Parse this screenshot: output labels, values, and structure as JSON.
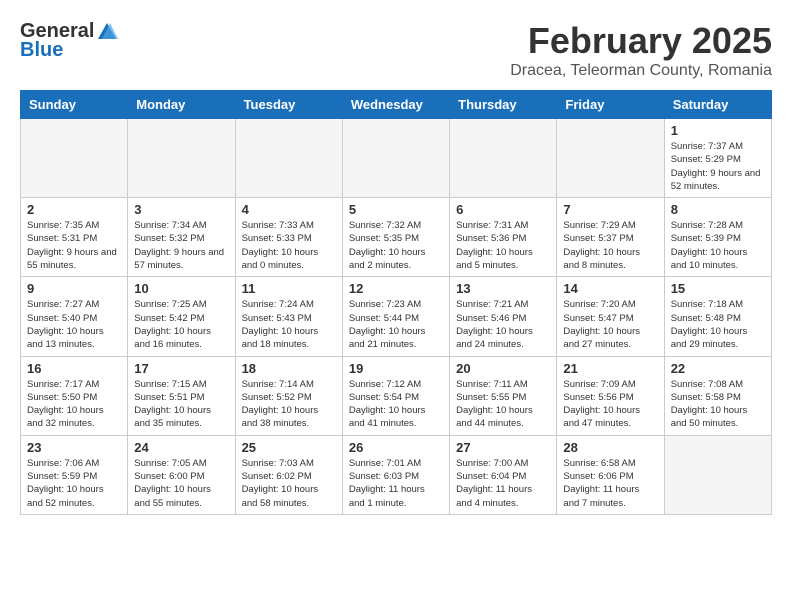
{
  "header": {
    "logo_general": "General",
    "logo_blue": "Blue",
    "title": "February 2025",
    "subtitle": "Dracea, Teleorman County, Romania"
  },
  "weekdays": [
    "Sunday",
    "Monday",
    "Tuesday",
    "Wednesday",
    "Thursday",
    "Friday",
    "Saturday"
  ],
  "weeks": [
    [
      {
        "day": "",
        "info": ""
      },
      {
        "day": "",
        "info": ""
      },
      {
        "day": "",
        "info": ""
      },
      {
        "day": "",
        "info": ""
      },
      {
        "day": "",
        "info": ""
      },
      {
        "day": "",
        "info": ""
      },
      {
        "day": "1",
        "info": "Sunrise: 7:37 AM\nSunset: 5:29 PM\nDaylight: 9 hours and 52 minutes."
      }
    ],
    [
      {
        "day": "2",
        "info": "Sunrise: 7:35 AM\nSunset: 5:31 PM\nDaylight: 9 hours and 55 minutes."
      },
      {
        "day": "3",
        "info": "Sunrise: 7:34 AM\nSunset: 5:32 PM\nDaylight: 9 hours and 57 minutes."
      },
      {
        "day": "4",
        "info": "Sunrise: 7:33 AM\nSunset: 5:33 PM\nDaylight: 10 hours and 0 minutes."
      },
      {
        "day": "5",
        "info": "Sunrise: 7:32 AM\nSunset: 5:35 PM\nDaylight: 10 hours and 2 minutes."
      },
      {
        "day": "6",
        "info": "Sunrise: 7:31 AM\nSunset: 5:36 PM\nDaylight: 10 hours and 5 minutes."
      },
      {
        "day": "7",
        "info": "Sunrise: 7:29 AM\nSunset: 5:37 PM\nDaylight: 10 hours and 8 minutes."
      },
      {
        "day": "8",
        "info": "Sunrise: 7:28 AM\nSunset: 5:39 PM\nDaylight: 10 hours and 10 minutes."
      }
    ],
    [
      {
        "day": "9",
        "info": "Sunrise: 7:27 AM\nSunset: 5:40 PM\nDaylight: 10 hours and 13 minutes."
      },
      {
        "day": "10",
        "info": "Sunrise: 7:25 AM\nSunset: 5:42 PM\nDaylight: 10 hours and 16 minutes."
      },
      {
        "day": "11",
        "info": "Sunrise: 7:24 AM\nSunset: 5:43 PM\nDaylight: 10 hours and 18 minutes."
      },
      {
        "day": "12",
        "info": "Sunrise: 7:23 AM\nSunset: 5:44 PM\nDaylight: 10 hours and 21 minutes."
      },
      {
        "day": "13",
        "info": "Sunrise: 7:21 AM\nSunset: 5:46 PM\nDaylight: 10 hours and 24 minutes."
      },
      {
        "day": "14",
        "info": "Sunrise: 7:20 AM\nSunset: 5:47 PM\nDaylight: 10 hours and 27 minutes."
      },
      {
        "day": "15",
        "info": "Sunrise: 7:18 AM\nSunset: 5:48 PM\nDaylight: 10 hours and 29 minutes."
      }
    ],
    [
      {
        "day": "16",
        "info": "Sunrise: 7:17 AM\nSunset: 5:50 PM\nDaylight: 10 hours and 32 minutes."
      },
      {
        "day": "17",
        "info": "Sunrise: 7:15 AM\nSunset: 5:51 PM\nDaylight: 10 hours and 35 minutes."
      },
      {
        "day": "18",
        "info": "Sunrise: 7:14 AM\nSunset: 5:52 PM\nDaylight: 10 hours and 38 minutes."
      },
      {
        "day": "19",
        "info": "Sunrise: 7:12 AM\nSunset: 5:54 PM\nDaylight: 10 hours and 41 minutes."
      },
      {
        "day": "20",
        "info": "Sunrise: 7:11 AM\nSunset: 5:55 PM\nDaylight: 10 hours and 44 minutes."
      },
      {
        "day": "21",
        "info": "Sunrise: 7:09 AM\nSunset: 5:56 PM\nDaylight: 10 hours and 47 minutes."
      },
      {
        "day": "22",
        "info": "Sunrise: 7:08 AM\nSunset: 5:58 PM\nDaylight: 10 hours and 50 minutes."
      }
    ],
    [
      {
        "day": "23",
        "info": "Sunrise: 7:06 AM\nSunset: 5:59 PM\nDaylight: 10 hours and 52 minutes."
      },
      {
        "day": "24",
        "info": "Sunrise: 7:05 AM\nSunset: 6:00 PM\nDaylight: 10 hours and 55 minutes."
      },
      {
        "day": "25",
        "info": "Sunrise: 7:03 AM\nSunset: 6:02 PM\nDaylight: 10 hours and 58 minutes."
      },
      {
        "day": "26",
        "info": "Sunrise: 7:01 AM\nSunset: 6:03 PM\nDaylight: 11 hours and 1 minute."
      },
      {
        "day": "27",
        "info": "Sunrise: 7:00 AM\nSunset: 6:04 PM\nDaylight: 11 hours and 4 minutes."
      },
      {
        "day": "28",
        "info": "Sunrise: 6:58 AM\nSunset: 6:06 PM\nDaylight: 11 hours and 7 minutes."
      },
      {
        "day": "",
        "info": ""
      }
    ]
  ]
}
